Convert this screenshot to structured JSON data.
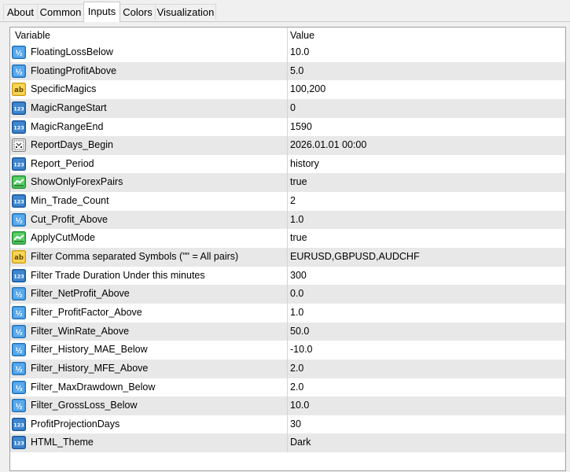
{
  "tabs": [
    {
      "label": "About"
    },
    {
      "label": "Common"
    },
    {
      "label": "Inputs"
    },
    {
      "label": "Colors"
    },
    {
      "label": "Visualization"
    }
  ],
  "active_tab": "Inputs",
  "grid": {
    "col_variable": "Variable",
    "col_value": "Value",
    "rows": [
      {
        "icon": "double-icon",
        "name": "FloatingLossBelow",
        "value": "10.0"
      },
      {
        "icon": "double-icon",
        "name": "FloatingProfitAbove",
        "value": "5.0"
      },
      {
        "icon": "string-icon",
        "name": "SpecificMagics",
        "value": "100,200"
      },
      {
        "icon": "int-icon",
        "name": "MagicRangeStart",
        "value": "0"
      },
      {
        "icon": "int-icon",
        "name": "MagicRangeEnd",
        "value": "1590"
      },
      {
        "icon": "datetime-icon",
        "name": "ReportDays_Begin",
        "value": "2026.01.01 00:00"
      },
      {
        "icon": "int-icon",
        "name": "Report_Period",
        "value": "history"
      },
      {
        "icon": "bool-icon",
        "name": "ShowOnlyForexPairs",
        "value": "true"
      },
      {
        "icon": "int-icon",
        "name": "Min_Trade_Count",
        "value": "2"
      },
      {
        "icon": "double-icon",
        "name": "Cut_Profit_Above",
        "value": "1.0"
      },
      {
        "icon": "bool-icon",
        "name": "ApplyCutMode",
        "value": "true"
      },
      {
        "icon": "string-icon",
        "name": "Filter Comma separated Symbols (\"\" = All pairs)",
        "value": "EURUSD,GBPUSD,AUDCHF"
      },
      {
        "icon": "int-icon",
        "name": "Filter Trade Duration Under this minutes",
        "value": "300"
      },
      {
        "icon": "double-icon",
        "name": "Filter_NetProfit_Above",
        "value": "0.0"
      },
      {
        "icon": "double-icon",
        "name": "Filter_ProfitFactor_Above",
        "value": "1.0"
      },
      {
        "icon": "double-icon",
        "name": "Filter_WinRate_Above",
        "value": "50.0"
      },
      {
        "icon": "double-icon",
        "name": "Filter_History_MAE_Below",
        "value": "-10.0"
      },
      {
        "icon": "double-icon",
        "name": "Filter_History_MFE_Above",
        "value": "2.0"
      },
      {
        "icon": "double-icon",
        "name": "Filter_MaxDrawdown_Below",
        "value": "2.0"
      },
      {
        "icon": "double-icon",
        "name": "Filter_GrossLoss_Below",
        "value": "10.0"
      },
      {
        "icon": "int-icon",
        "name": "ProfitProjectionDays",
        "value": "30"
      },
      {
        "icon": "int-icon",
        "name": "HTML_Theme",
        "value": "Dark"
      }
    ]
  }
}
